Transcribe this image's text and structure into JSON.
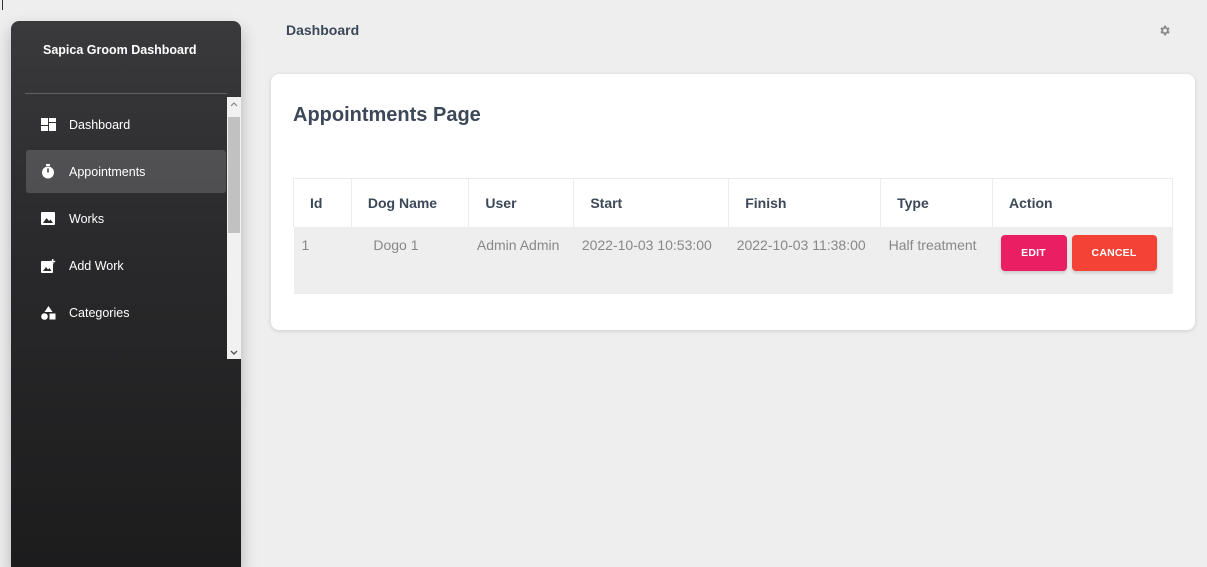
{
  "sidebar": {
    "brand": "Sapica Groom Dashboard",
    "items": [
      {
        "label": "Dashboard",
        "icon": "dashboard-icon",
        "active": false
      },
      {
        "label": "Appointments",
        "icon": "timer-icon",
        "active": true
      },
      {
        "label": "Works",
        "icon": "image-icon",
        "active": false
      },
      {
        "label": "Add Work",
        "icon": "add-photo-icon",
        "active": false
      },
      {
        "label": "Categories",
        "icon": "category-icon",
        "active": false
      }
    ]
  },
  "header": {
    "title": "Dashboard",
    "settings_icon": "gear-icon"
  },
  "card": {
    "title": "Appointments Page",
    "table": {
      "columns": [
        "Id",
        "Dog Name",
        "User",
        "Start",
        "Finish",
        "Type",
        "Action"
      ],
      "rows": [
        {
          "id": "1",
          "dog_name": "Dogo 1",
          "user": "Admin Admin",
          "start": "2022-10-03 10:53:00",
          "finish": "2022-10-03 11:38:00",
          "type": "Half treatment",
          "edit_label": "EDIT",
          "cancel_label": "CANCEL"
        }
      ]
    }
  },
  "colors": {
    "edit": "#e91e63",
    "cancel": "#f44336",
    "sidebar_bg": "#2a2a2c"
  }
}
